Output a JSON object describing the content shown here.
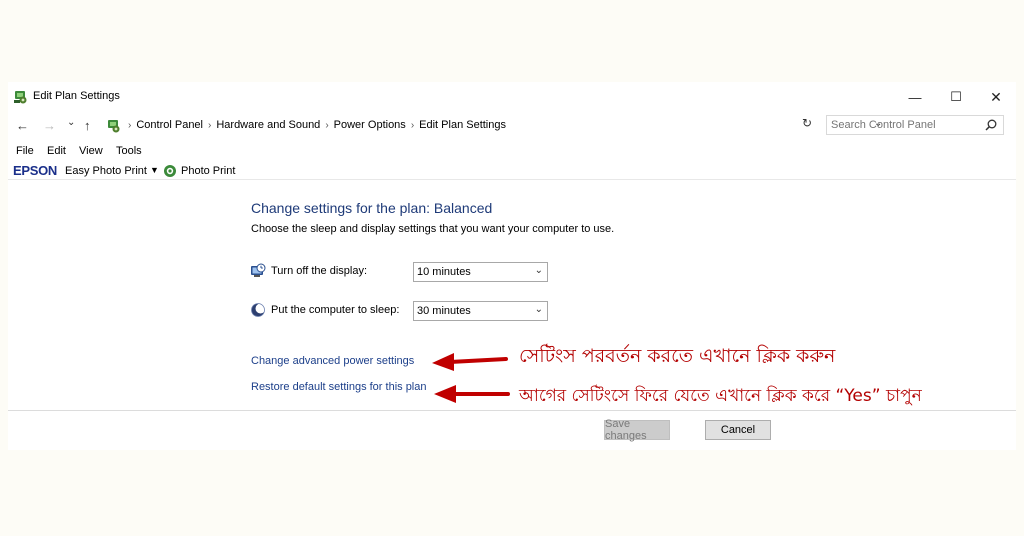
{
  "window": {
    "title": "Edit Plan Settings",
    "controls": {
      "minimize": "—",
      "maximize": "☐",
      "close": "✕"
    }
  },
  "nav": {
    "back": "←",
    "forward": "→",
    "recent": "⌄",
    "up": "↑",
    "breadcrumbs": [
      "Control Panel",
      "Hardware and Sound",
      "Power Options",
      "Edit Plan Settings"
    ],
    "separator": "›",
    "address_dropdown": "⌄",
    "refresh": "↻",
    "search_placeholder": "Search Control Panel"
  },
  "menu": [
    "File",
    "Edit",
    "View",
    "Tools"
  ],
  "epson_toolbar": {
    "brand": "EPSON",
    "easy_photo_print": "Easy Photo Print",
    "dropdown": "▼",
    "photo_print": "Photo Print"
  },
  "main": {
    "heading": "Change settings for the plan: Balanced",
    "subheading": "Choose the sleep and display settings that you want your computer to use.",
    "display": {
      "label": "Turn off the display:",
      "value": "10 minutes"
    },
    "sleep": {
      "label": "Put the computer to sleep:",
      "value": "30 minutes"
    },
    "advanced_link": "Change advanced power settings",
    "restore_link": "Restore default settings for this plan",
    "save_button": "Save changes",
    "cancel_button": "Cancel"
  },
  "annotations": {
    "advanced": "সেটিংস পরবর্তন করতে এখানে ক্লিক করুন",
    "restore": "আগের সেটিংসে ফিরে যেতে এখানে ক্লিক করে “Yes” চাপুন",
    "color": "#b30000"
  },
  "colors": {
    "heading": "#1e3a78",
    "link": "#1c3f8a",
    "epson": "#1a2f8a",
    "page_background": "#fdfcf6"
  }
}
